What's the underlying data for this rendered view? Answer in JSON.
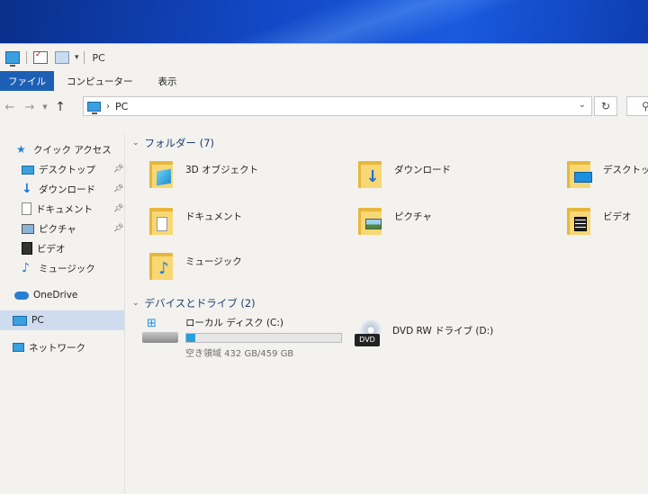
{
  "window": {
    "title": "PC"
  },
  "ribbon": {
    "tabs": [
      "ファイル",
      "コンピューター",
      "表示"
    ]
  },
  "address": {
    "path": "PC"
  },
  "sidebar": {
    "quick_access": "クイック アクセス",
    "items": [
      {
        "label": "デスクトップ",
        "pinned": true
      },
      {
        "label": "ダウンロード",
        "pinned": true
      },
      {
        "label": "ドキュメント",
        "pinned": true
      },
      {
        "label": "ピクチャ",
        "pinned": true
      },
      {
        "label": "ビデオ",
        "pinned": false
      },
      {
        "label": "ミュージック",
        "pinned": false
      }
    ],
    "onedrive": "OneDrive",
    "pc": "PC",
    "network": "ネットワーク"
  },
  "folders_group": {
    "header": "フォルダー (7)",
    "items": [
      {
        "label": "3D オブジェクト",
        "icon": "3d-objects-icon"
      },
      {
        "label": "ダウンロード",
        "icon": "downloads-icon"
      },
      {
        "label": "デスクトップ",
        "icon": "desktop-icon"
      },
      {
        "label": "ドキュメント",
        "icon": "documents-icon"
      },
      {
        "label": "ピクチャ",
        "icon": "pictures-icon"
      },
      {
        "label": "ビデオ",
        "icon": "videos-icon"
      },
      {
        "label": "ミュージック",
        "icon": "music-icon"
      }
    ]
  },
  "drives_group": {
    "header": "デバイスとドライブ (2)",
    "local_disk": {
      "label": "ローカル ディスク (C:)",
      "free_text": "空き領域 432 GB/459 GB",
      "used_fraction": 0.06
    },
    "dvd": {
      "label": "DVD RW ドライブ (D:)",
      "icon_text": "DVD"
    }
  },
  "colors": {
    "ribbon_active": "#1c5fb5",
    "selected_nav": "#cfdcef",
    "folder_yellow": "#f8d775",
    "drive_bar": "#26a0da"
  }
}
